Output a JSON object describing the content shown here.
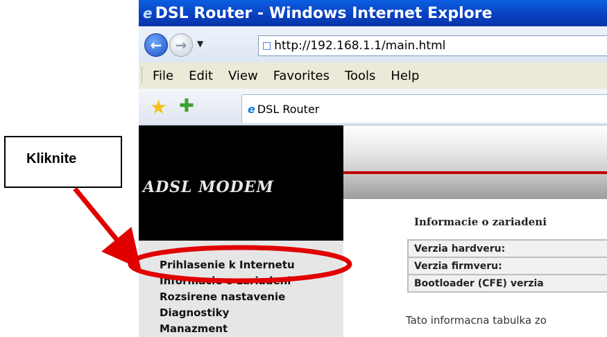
{
  "browser": {
    "window_title": "DSL Router - Windows Internet Explore",
    "address_url": "http://192.168.1.1/main.html",
    "menu": [
      "File",
      "Edit",
      "View",
      "Favorites",
      "Tools",
      "Help"
    ],
    "tab_title": "DSL Router",
    "icons": {
      "back": "back-arrow-icon",
      "forward": "forward-arrow-icon",
      "favorites": "star-icon",
      "add_favorite": "add-favorite-icon"
    }
  },
  "page": {
    "logo_text": "ADSL MODEM",
    "sidebar": [
      "Prihlasenie k Internetu",
      "Informacie o zariadeni",
      "Rozsirene nastavenie",
      "Diagnostiky",
      "Manazment"
    ],
    "title": "Informacie o zariadeni",
    "table_rows": [
      "Verzia hardveru:",
      "Verzia firmveru:",
      "Bootloader (CFE) verzia"
    ],
    "note": "Tato informacna tabulka zo"
  },
  "annotation": {
    "callout_text": "Kliknite",
    "color": "#e00000"
  }
}
